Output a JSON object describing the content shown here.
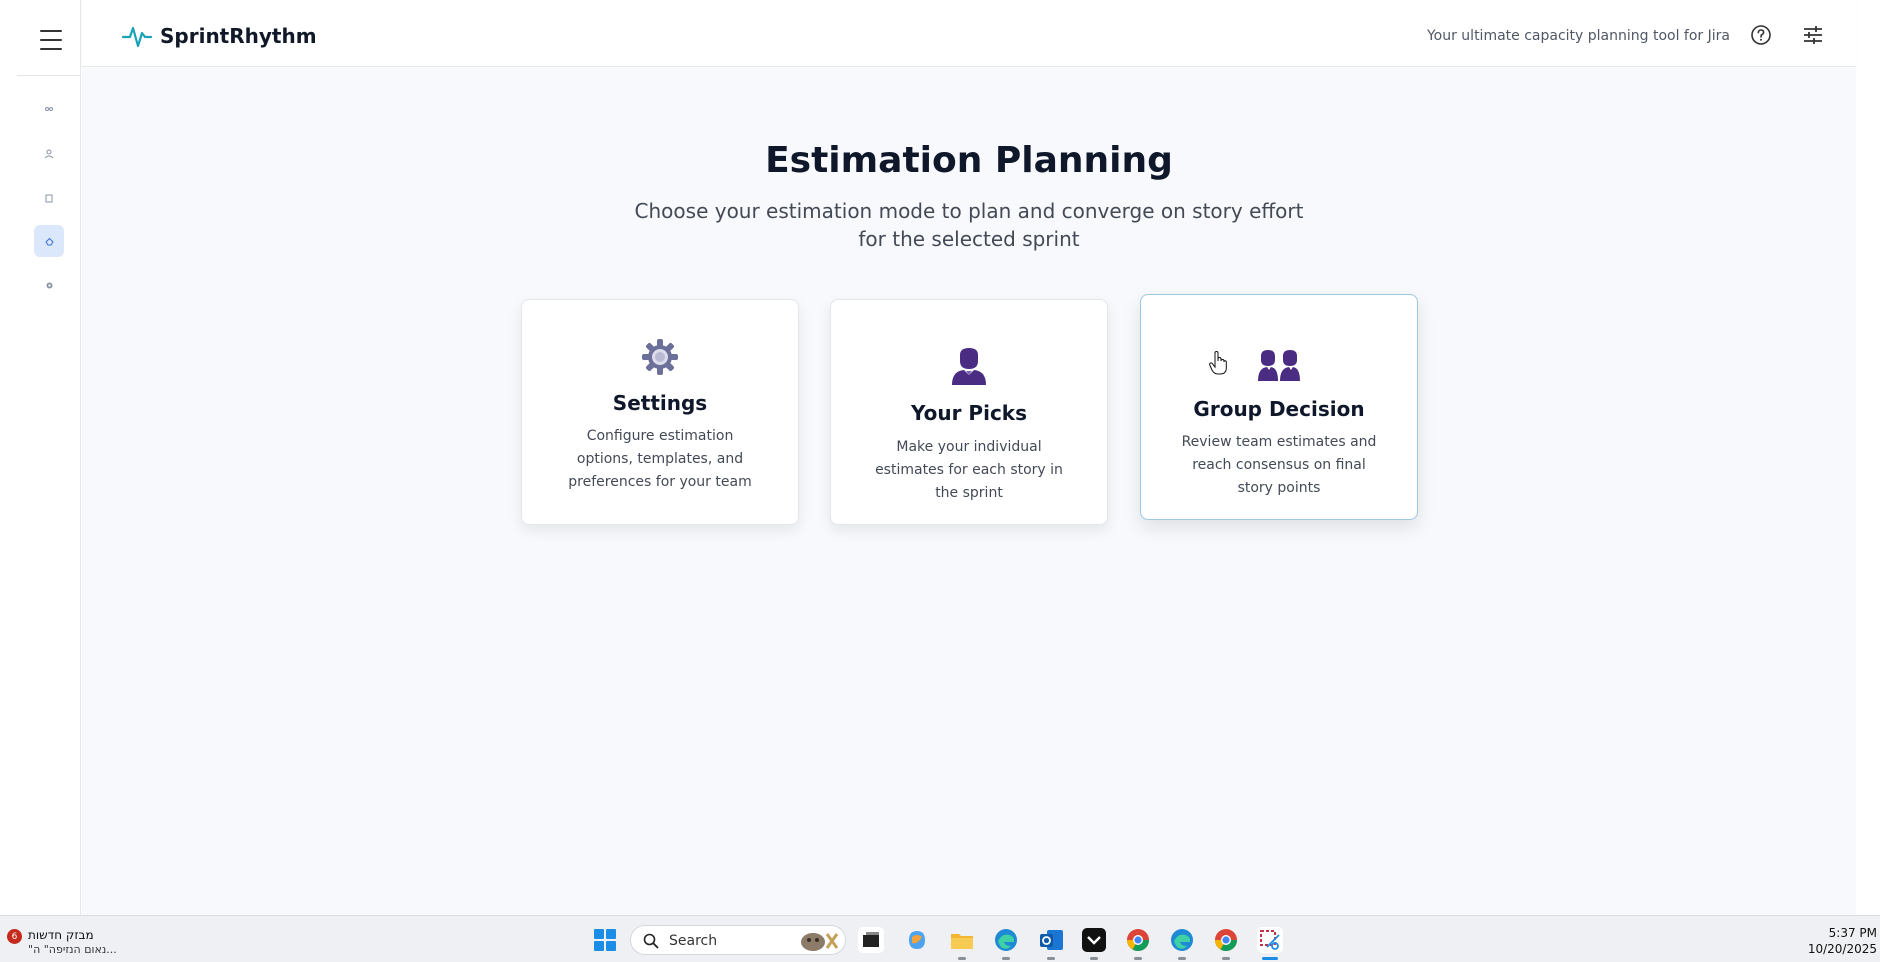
{
  "app": {
    "name": "SprintRhythm",
    "tagline": "Your ultimate capacity planning tool for Jira"
  },
  "rail": {
    "items": [
      {
        "icon": "people-icon",
        "active": false
      },
      {
        "icon": "person-icon",
        "active": false
      },
      {
        "icon": "document-icon",
        "active": false
      },
      {
        "icon": "estimation-icon",
        "active": true
      },
      {
        "icon": "gear-icon",
        "active": false
      }
    ]
  },
  "page": {
    "title": "Estimation Planning",
    "subtitle": "Choose your estimation mode to plan and converge on story effort for the selected sprint"
  },
  "cards": [
    {
      "title": "Settings",
      "description": "Configure estimation options, templates, and preferences for your team",
      "icon": "gear-icon",
      "icon_color": "#6b6f9a",
      "selected": false
    },
    {
      "title": "Your Picks",
      "description": "Make your individual estimates for each story in the sprint",
      "icon": "person-icon",
      "icon_color": "#4b2c83",
      "selected": false
    },
    {
      "title": "Group Decision",
      "description": "Review team estimates and reach consensus on final story points",
      "icon": "group-icon",
      "icon_color": "#4b2c83",
      "selected": true
    }
  ],
  "taskbar": {
    "news_badge": "6",
    "news_title": "מבזק חדשות",
    "news_snippet": "\"נאום הנזיפה\" ה...",
    "search_placeholder": "Search",
    "time": "5:37 PM",
    "date": "10/20/2025"
  },
  "colors": {
    "accent_teal": "#1aa3b8",
    "card_icon_purple": "#4b2c83",
    "selected_border": "#9cc8e6",
    "main_bg": "#f7f9fc"
  }
}
